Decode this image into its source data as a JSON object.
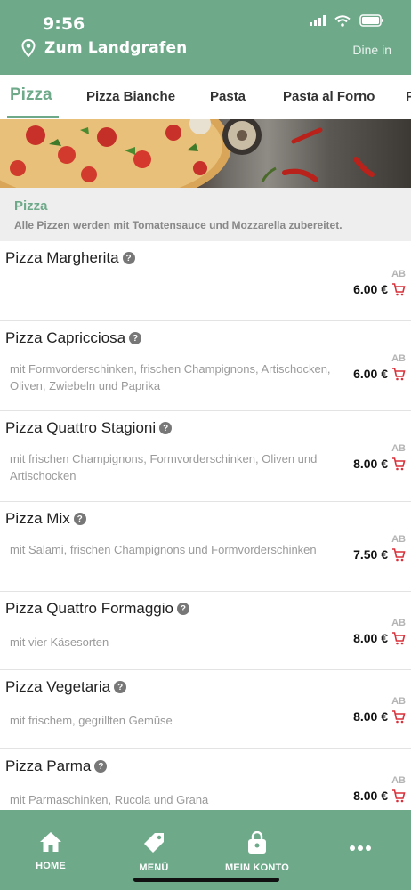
{
  "status_bar": {
    "time": "9:56"
  },
  "header": {
    "location_name": "Zum Landgrafen",
    "mode": "Dine in",
    "location_icon": "map-pin-icon"
  },
  "tabs": [
    {
      "label": "Pizza",
      "active": true
    },
    {
      "label": "Pizza Bianche",
      "active": false
    },
    {
      "label": "Pasta",
      "active": false
    },
    {
      "label": "Pasta al Forno",
      "active": false
    },
    {
      "label": "P",
      "active": false
    }
  ],
  "section": {
    "title": "Pizza",
    "subtitle": "Alle Pizzen werden mit Tomatensauce und Mozzarella zubereitet."
  },
  "items": [
    {
      "name": "Pizza Margherita",
      "description": "",
      "ab": "AB",
      "price": "6.00 €"
    },
    {
      "name": "Pizza Capricciosa",
      "description": "mit Formvorderschinken, frischen Champignons, Artischocken, Oliven, Zwiebeln und Paprika",
      "ab": "AB",
      "price": "6.00 €"
    },
    {
      "name": "Pizza Quattro Stagioni",
      "description": "mit frischen Champignons, Formvorderschinken, Oliven und Artischocken",
      "ab": "AB",
      "price": "8.00 €"
    },
    {
      "name": "Pizza Mix",
      "description": "mit Salami, frischen Champignons und Formvorderschinken",
      "ab": "AB",
      "price": "7.50 €"
    },
    {
      "name": "Pizza Quattro Formaggio",
      "description": "mit vier Käsesorten",
      "ab": "AB",
      "price": "8.00 €"
    },
    {
      "name": "Pizza Vegetaria",
      "description": "mit frischem, gegrillten Gemüse",
      "ab": "AB",
      "price": "8.00 €"
    },
    {
      "name": "Pizza Parma",
      "description": "mit Parmaschinken, Rucola und Grana",
      "ab": "AB",
      "price": "8.00 €"
    }
  ],
  "bottom_nav": [
    {
      "label": "HOME",
      "icon": "home-icon"
    },
    {
      "label": "MENÜ",
      "icon": "tag-icon"
    },
    {
      "label": "MEIN KONTO",
      "icon": "shopping-bag-icon"
    },
    {
      "label": "",
      "icon": "more-dots-icon"
    }
  ],
  "colors": {
    "accent": "#6ea98a",
    "cart": "#d9303a",
    "price": "#111111"
  }
}
